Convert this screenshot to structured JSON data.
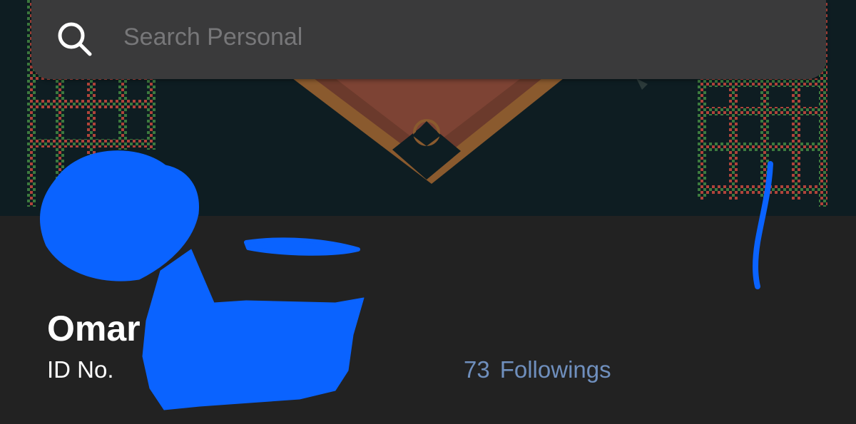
{
  "search": {
    "placeholder": "Search Personal",
    "icon": "search-icon"
  },
  "profile": {
    "name": "Omar",
    "id_label": "ID No.",
    "followings_count": "73",
    "followings_label": "Followings"
  },
  "colors": {
    "banner_bg": "#0e1d22",
    "page_bg": "#222222",
    "search_bg": "#3a3a3b",
    "accent_text": "#6f8fbd",
    "redaction": "#0a63ff"
  }
}
